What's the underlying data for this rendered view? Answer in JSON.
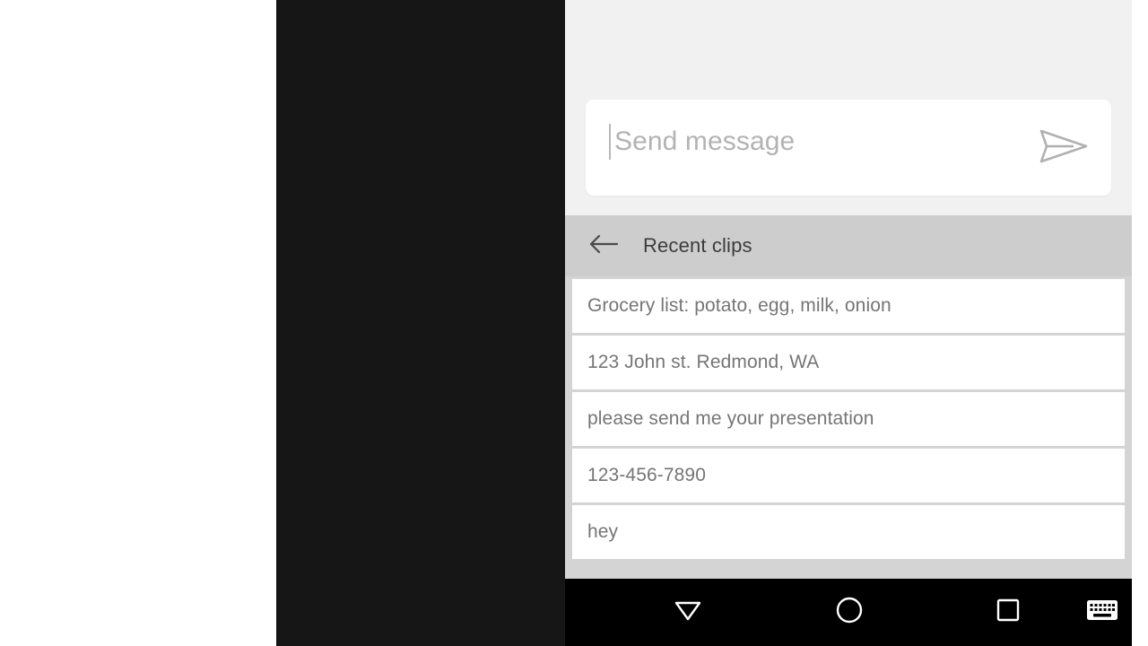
{
  "device": {
    "frame_color": "#161616",
    "screen_bg": "#f1f1f1",
    "nav_bar_color": "#000000"
  },
  "compose": {
    "placeholder": "Send message",
    "value": "",
    "caret_visible": true,
    "send_icon": "send-paper-plane-icon",
    "card_color": "#ffffff"
  },
  "recent_clips": {
    "back_icon": "arrow-left-icon",
    "title": "Recent clips",
    "bar_color": "#cdcdcd",
    "items": [
      {
        "text": "Grocery list: potato, egg, milk, onion"
      },
      {
        "text": "123 John st. Redmond, WA"
      },
      {
        "text": "please send me your presentation"
      },
      {
        "text": "123-456-7890"
      },
      {
        "text": "hey"
      }
    ]
  },
  "nav_bar": {
    "buttons": [
      {
        "name": "back-hide-keyboard",
        "icon": "triangle-down-icon"
      },
      {
        "name": "home",
        "icon": "circle-icon"
      },
      {
        "name": "recents",
        "icon": "square-icon"
      },
      {
        "name": "switch-keyboard",
        "icon": "keyboard-icon"
      }
    ]
  }
}
